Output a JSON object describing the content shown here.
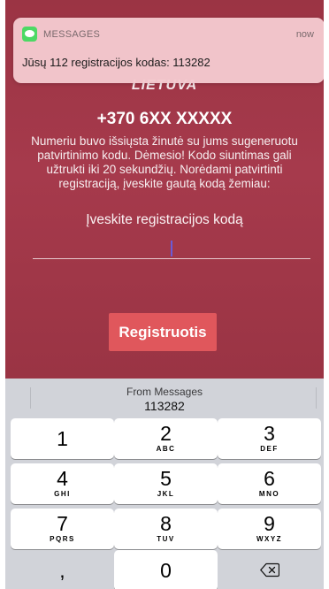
{
  "notification": {
    "app_name": "MESSAGES",
    "time": "now",
    "body": "Jūsų 112 registracijos kodas: 113282",
    "icon": "messages-icon"
  },
  "app": {
    "country": "LIETUVA",
    "phone": "+370 6XX XXXXX",
    "description": "Numeriu buvo išsiųsta žinutė su jums sugeneruotu patvirtinimo kodu. Dėmesio! Kodo siuntimas gali užtrukti iki 20 sekundžių. Norėdami patvirtinti registraciją, įveskite gautą kodą žemiau:",
    "code_label": "Įveskite registracijos kodą",
    "code_value": "",
    "register_button": "Registruotis"
  },
  "keyboard": {
    "suggestion": {
      "source": "From Messages",
      "code": "113282"
    },
    "keys": [
      {
        "num": "1",
        "letters": ""
      },
      {
        "num": "2",
        "letters": "ABC"
      },
      {
        "num": "3",
        "letters": "DEF"
      },
      {
        "num": "4",
        "letters": "GHI"
      },
      {
        "num": "5",
        "letters": "JKL"
      },
      {
        "num": "6",
        "letters": "MNO"
      },
      {
        "num": "7",
        "letters": "PQRS"
      },
      {
        "num": "8",
        "letters": "TUV"
      },
      {
        "num": "9",
        "letters": "WXYZ"
      },
      {
        "num": ",",
        "letters": ""
      },
      {
        "num": "0",
        "letters": ""
      }
    ],
    "backspace_icon": "backspace-icon"
  },
  "colors": {
    "app_background": "#a63a4c",
    "button": "#e0575c",
    "caret": "#6b5bd6",
    "keyboard_background": "#d1d3d9"
  }
}
